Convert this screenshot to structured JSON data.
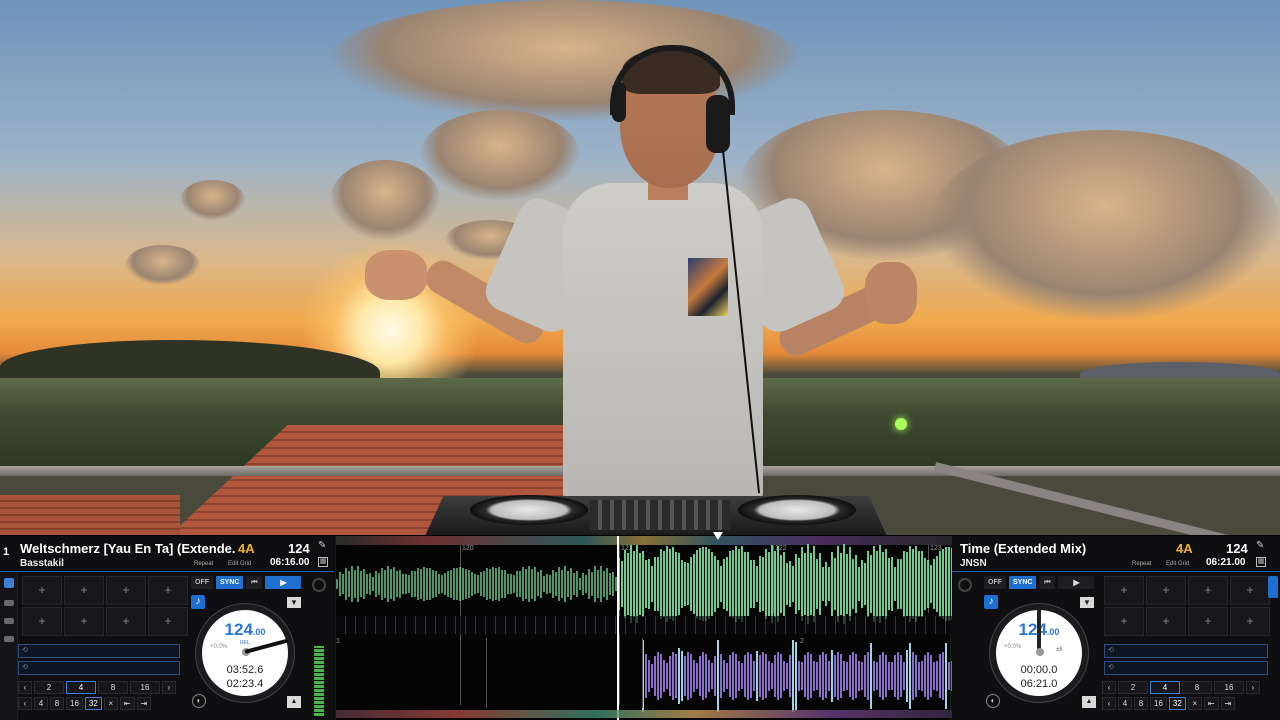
{
  "deck_left": {
    "number": "1",
    "title": "Weltschmerz [Yau En Ta] (Extende...",
    "artist": "Basstakil",
    "key": "4A",
    "bpm": "124",
    "repeat_label": "Repeat",
    "edit_grid_label": "Edit Grid",
    "duration": "06:16.00",
    "off_label": "OFF",
    "sync_label": "SYNC",
    "jog_bpm": "124",
    "jog_bpm_dec": ".00",
    "jog_pitch": "+0.0%",
    "jog_rel": "REL",
    "elapsed": "03:52.6",
    "remaining": "02:23.4",
    "beatjump_row1": [
      "2",
      "4",
      "8",
      "16"
    ],
    "beatjump_row2": [
      "4",
      "8",
      "16",
      "32"
    ],
    "pad_symbol": "+"
  },
  "deck_right": {
    "title": "Time (Extended Mix)",
    "artist": "JNSN",
    "key": "4A",
    "bpm": "124",
    "repeat_label": "Repeat",
    "edit_grid_label": "Edit Grid",
    "duration": "06:21.00",
    "off_label": "OFF",
    "sync_label": "SYNC",
    "jog_bpm": "124",
    "jog_bpm_dec": ".00",
    "jog_pitch": "+0.0%",
    "jog_sync": "±8",
    "elapsed": "00:00.0",
    "remaining": "06:21.0",
    "beatjump_row1": [
      "2",
      "4",
      "8",
      "16"
    ],
    "beatjump_row2": [
      "4",
      "8",
      "16",
      "32"
    ],
    "pad_symbol": "+"
  },
  "waveform": {
    "bar_markers": [
      "120",
      "121",
      "122",
      "123"
    ],
    "lower_markers": [
      "1",
      "2"
    ]
  },
  "colors": {
    "accent_blue": "#1f6fd0",
    "key_color": "#f0b12b",
    "wave_upper": "#7ee0a0",
    "wave_lower": "#8a6fc9"
  }
}
